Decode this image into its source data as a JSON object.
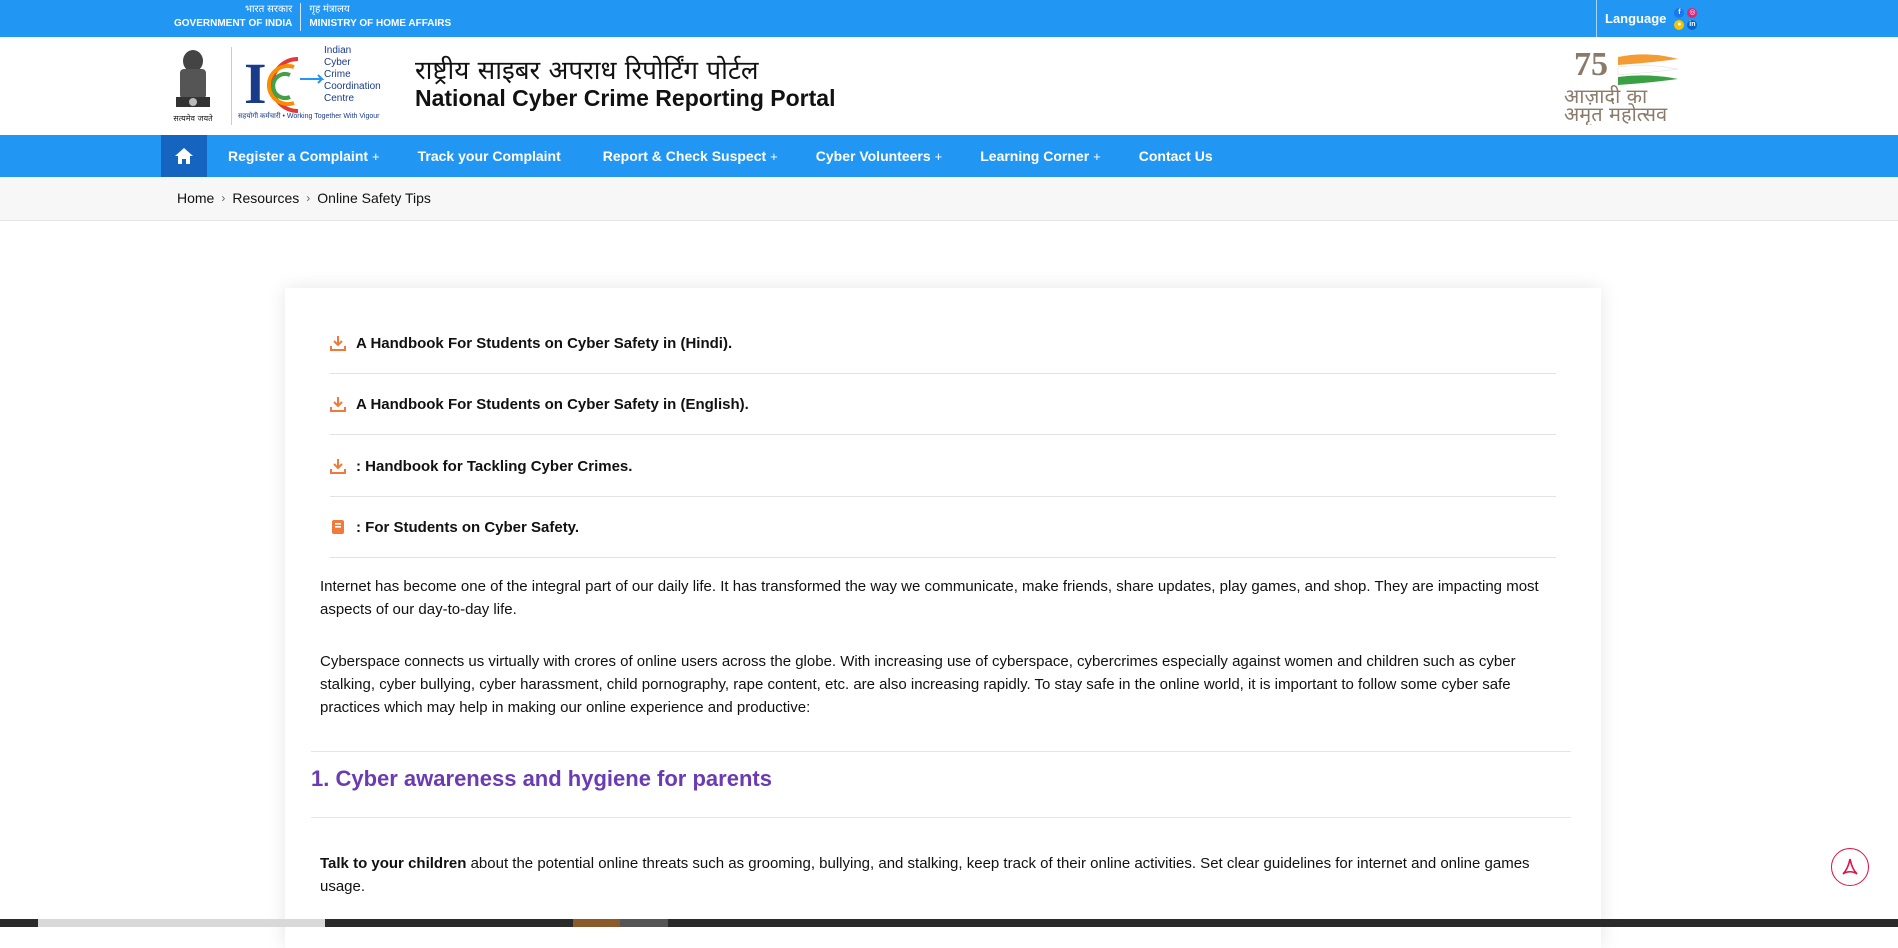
{
  "gov_bar": {
    "hi_left": "भारत सरकार",
    "en_left": "GOVERNMENT OF INDIA",
    "hi_right": "गृह मंत्रालय",
    "en_right": "MINISTRY OF HOME AFFAIRS",
    "language_label": "Language",
    "social_icons": [
      "facebook-icon",
      "instagram-icon",
      "koo-icon",
      "linkedin-icon"
    ]
  },
  "header": {
    "emblem_caption": "सत्यमेव जयते",
    "i4c_lines": [
      "Indian",
      "Cyber",
      "Crime",
      "Coordination",
      "Centre"
    ],
    "i4c_tagline": "सहयोगी कर्मचारी • Working Together With Vigour",
    "title_hi": "राष्ट्रीय साइबर अपराध रिपोर्टिंग पोर्टल",
    "title_en": "National Cyber Crime Reporting Portal",
    "azadi_lines": [
      "आज़ादी का",
      "अमृत महोत्सव"
    ]
  },
  "nav": {
    "items": [
      {
        "label": "Register a Complaint",
        "has_sub": "+"
      },
      {
        "label": "Track your Complaint",
        "has_sub": ""
      },
      {
        "label": "Report & Check Suspect",
        "has_sub": "+"
      },
      {
        "label": "Cyber Volunteers",
        "has_sub": "+"
      },
      {
        "label": "Learning Corner",
        "has_sub": "+"
      },
      {
        "label": "Contact Us",
        "has_sub": ""
      }
    ]
  },
  "breadcrumb": [
    "Home",
    "Resources",
    "Online Safety Tips"
  ],
  "downloads": [
    {
      "label": "A Handbook For Students on Cyber Safety in (Hindi).",
      "icon": "download-icon"
    },
    {
      "label": "A Handbook For Students on Cyber Safety in (English).",
      "icon": "download-icon"
    },
    {
      "label": ": Handbook for Tackling Cyber Crimes.",
      "icon": "download-icon"
    },
    {
      "label": ": For Students on Cyber Safety.",
      "icon": "book-icon"
    }
  ],
  "content": {
    "p1": "Internet has become one of the integral part of our daily life. It has transformed the way we communicate, make friends, share updates, play games, and shop. They are impacting most aspects of our day-to-day life.",
    "p2": "Cyberspace connects us virtually with crores of online users across the globe. With increasing use of cyberspace, cybercrimes especially against women and children such as cyber stalking, cyber bullying, cyber harassment, child pornography, rape content, etc. are also increasing rapidly. To stay safe in the online world, it is important to follow some cyber safe practices which may help in making our online experience and productive:",
    "section_title": "1. Cyber awareness and hygiene for parents",
    "p3_bold": "Talk to your children",
    "p3_rest": " about the potential online threats such as grooming, bullying, and stalking, keep track of their online activities. Set clear guidelines for internet and online games usage."
  },
  "colors": {
    "primary": "#2196f3",
    "home_active": "#1565c0",
    "section_title": "#6a3bb3",
    "icon_orange": "#f07a3a"
  }
}
